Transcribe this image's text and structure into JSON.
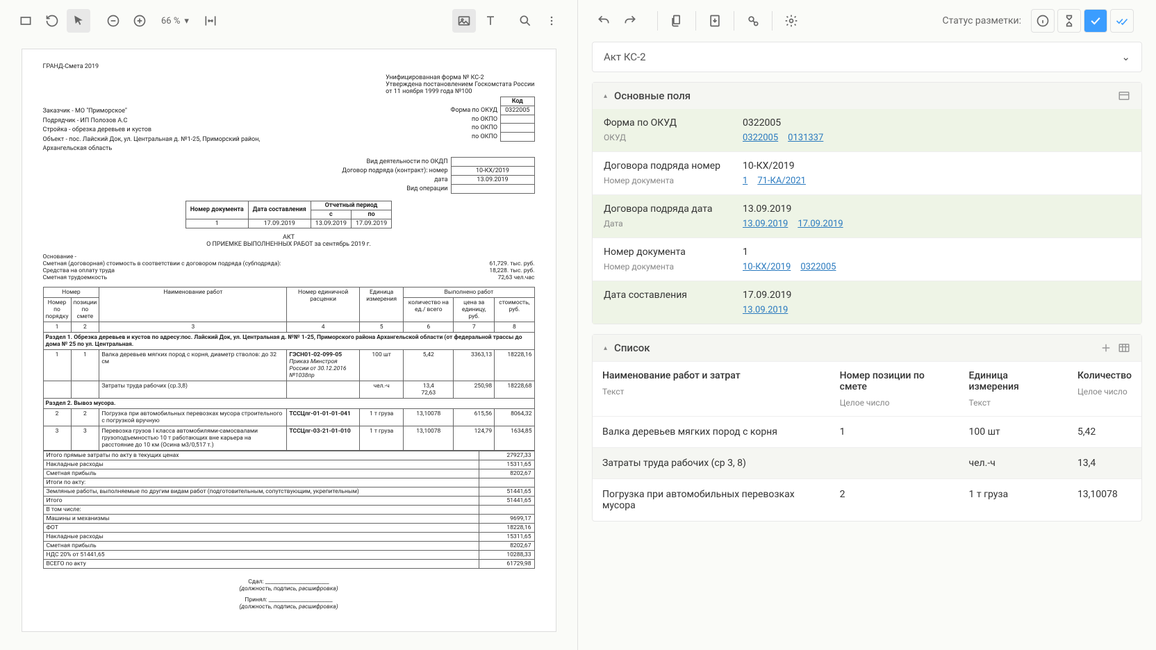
{
  "toolbar_left": {
    "zoom": "66 %"
  },
  "toolbar_right": {
    "status_label": "Статус разметки:"
  },
  "doc_type": "Акт КС-2",
  "sections": {
    "main": {
      "title": "Основные поля"
    },
    "list": {
      "title": "Список"
    }
  },
  "fields": [
    {
      "name": "Форма по ОКУД",
      "sub": "ОКУД",
      "value": "0322005",
      "links": [
        "0322005",
        "0131337"
      ],
      "alt": true
    },
    {
      "name": "Договора подряда номер",
      "sub": "Номер документа",
      "value": "10-КХ/2019",
      "links": [
        "1",
        "71-КА/2021"
      ],
      "alt": false
    },
    {
      "name": "Договора подряда дата",
      "sub": "Дата",
      "value": "13.09.2019",
      "links": [
        "13.09.2019",
        "17.09.2019"
      ],
      "alt": true
    },
    {
      "name": "Номер документа",
      "sub": "Номер документа",
      "value": "1",
      "links": [
        "10-КХ/2019",
        "0322005"
      ],
      "alt": false
    },
    {
      "name": "Дата составления",
      "sub": "",
      "value": "17.09.2019",
      "links": [
        "13.09.2019"
      ],
      "alt": true
    }
  ],
  "list_columns": [
    {
      "name": "Наименование работ и затрат",
      "type": "Текст"
    },
    {
      "name": "Номер позиции по смете",
      "type": "Целое число"
    },
    {
      "name": "Единица измерения",
      "type": "Текст"
    },
    {
      "name": "Количество",
      "type": "Целое число"
    }
  ],
  "list_rows": [
    {
      "cells": [
        "Валка деревьев мягких пород с корня",
        "1",
        "100 шт",
        "5,42"
      ],
      "alt": false
    },
    {
      "cells": [
        "Затраты труда рабочих (ср 3, 8)",
        "",
        "чел.-ч",
        "13,4"
      ],
      "alt": true
    },
    {
      "cells": [
        "Погрузка при автомобильных перевозках мусора",
        "2",
        "1 т груза",
        "13,10078"
      ],
      "alt": false
    }
  ],
  "document": {
    "software": "ГРАНД-Смета 2019",
    "form_info": [
      "Унифицированная форма № КС-2",
      "Утверждена постановлением Госкомстата России",
      "от 11 ноября 1999 года №100"
    ],
    "code_header": "Код",
    "code_rows": [
      [
        "Форма по ОКУД",
        "0322005"
      ],
      [
        "по ОКПО",
        ""
      ],
      [
        "по ОКПО",
        ""
      ],
      [
        "по ОКПО",
        ""
      ]
    ],
    "customer": "Заказчик  - МО \"Приморское\"",
    "contractor": "Подрядчик  - ИП Полозов А.С",
    "construction": "Стройка  - обрезка деревьев и кустов",
    "object": "Объект  - пос. Лайский Док, ул. Центральная д. №1-25, Приморский район, Архангельская область",
    "activity_label": "Вид деятельности по ОКДП",
    "contract_label": "Договор подряда (контракт):",
    "contract_rows": [
      [
        "номер",
        "10-КХ/2019"
      ],
      [
        "дата",
        "13.09.2019"
      ]
    ],
    "op_type_label": "Вид операции",
    "doc_info_headers": [
      "Номер документа",
      "Дата составления",
      "Отчетный период"
    ],
    "doc_info_sub": [
      "с",
      "по"
    ],
    "doc_info_values": [
      "1",
      "17.09.2019",
      "13.09.2019",
      "17.09.2019"
    ],
    "act_title": "АКТ",
    "act_subtitle": "О ПРИЕМКЕ ВЫПОЛНЕННЫХ РАБОТ за сентябрь 2019 г.",
    "basis_label": "Основание -",
    "summary_rows": [
      [
        "Сметная (договорная) стоимость в соответствии с договором подряда (субподряда):",
        "61,729. тыс. руб."
      ],
      [
        "Средства на оплату труда",
        "18,228. тыс. руб."
      ],
      [
        "Сметная трудоемкость",
        "72,63 чел.час"
      ]
    ],
    "table_headers": {
      "num_order": "Номер по порядку",
      "pos": "позиции по смете",
      "work_name": "Наименование работ",
      "unit_code": "Номер единичной расценки",
      "unit": "Единица измерения",
      "done": "Выполнено работ",
      "qty": "количество на ед./ всего",
      "price": "цена за единицу, руб.",
      "cost": "стоимость, руб."
    },
    "col_nums": [
      "1",
      "2",
      "3",
      "4",
      "5",
      "6",
      "7",
      "8"
    ],
    "section1": "Раздел 1. Обрезка деревьев и кустов по адресу:пос. Лайский Док, ул. Центральная д. №№ 1-25, Приморского района Архангельской области (от федеральной трассы до дома № 25 по ул. Центральная.",
    "row1": {
      "n": "1",
      "pos": "1",
      "name": "Валка деревьев мягких пород с корня, диаметр стволов: до 32 см",
      "code": "ГЭСН01-02-099-05",
      "code_sub": "Приказ Минстроя России от 30.12.2016 №1038пр",
      "unit": "100 шт",
      "qty": "5,42",
      "price": "3363,13",
      "cost": "18228,16"
    },
    "row1b": {
      "name": "Затраты труда рабочих (ср.3,8)",
      "unit": "чел.-ч",
      "qty": "13,4\n72,63",
      "price": "250,98",
      "cost": "18228,68"
    },
    "section2": "Раздел 2. Вывоз мусора.",
    "row2": {
      "n": "2",
      "pos": "2",
      "name": "Погрузка при автомобильных перевозках мусора строительного с погрузкой вручную",
      "code": "ТССЦпг-01-01-01-041",
      "unit": "1 т груза",
      "qty": "13,10078",
      "price": "615,56",
      "cost": "8064,32"
    },
    "row3": {
      "n": "3",
      "pos": "3",
      "name": "Перевозка грузов I класса автомобилями-самосвалами грузоподъемностью 10 т работающих вне карьера на расстояние до 10 км (Осина м3/0,517 т.)",
      "code": "ТССЦпг-03-21-01-010",
      "unit": "1 т груза",
      "qty": "13,10078",
      "price": "124,79",
      "cost": "1634,85"
    },
    "totals": [
      [
        "Итого прямые затраты по акту в текущих ценах",
        "27927,33"
      ],
      [
        "Накладные расходы",
        "15311,65"
      ],
      [
        "Сметная прибыль",
        "8202,67"
      ],
      [
        "Итоги по акту:",
        ""
      ],
      [
        "  Земляные работы, выполняемые по другим видам работ (подготовительным, сопутствующим, укрепительным)",
        "51441,65"
      ],
      [
        "Итого",
        "51441,65"
      ],
      [
        "В том числе:",
        ""
      ],
      [
        "  Машины и механизмы",
        "9699,17"
      ],
      [
        "  ФОТ",
        "18228,16"
      ],
      [
        "  Накладные расходы",
        "15311,65"
      ],
      [
        "  Сметная прибыль",
        "8202,67"
      ],
      [
        "  НДС 20% от 51441,65",
        "10288,33"
      ],
      [
        "  ВСЕГО по акту",
        "61729,98"
      ]
    ],
    "sign1_label": "Сдал:",
    "sign2_label": "Принял:",
    "sign_sub": "(должность, подпись, расшифровка)"
  }
}
